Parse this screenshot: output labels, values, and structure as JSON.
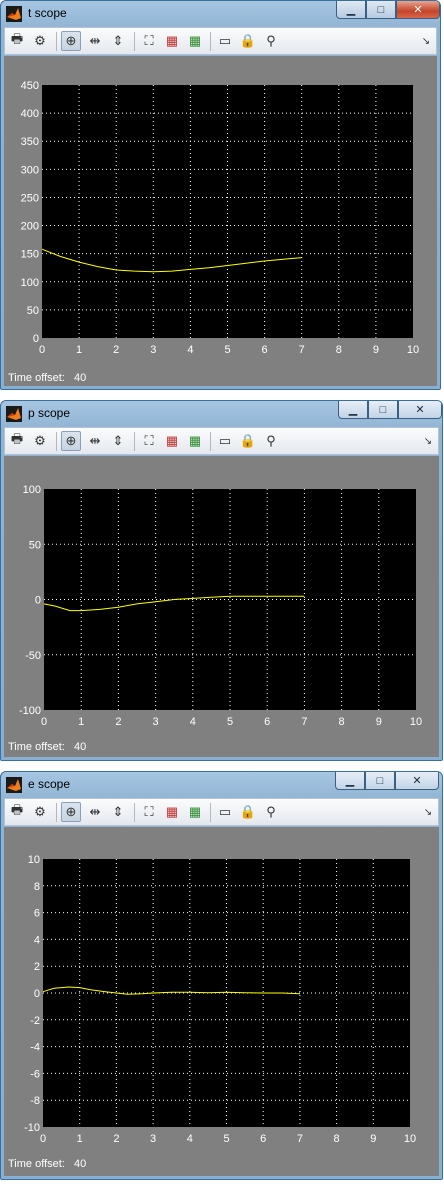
{
  "windows": [
    {
      "title": "t scope",
      "active": true,
      "time_offset_label": "Time offset:",
      "time_offset_value": "40",
      "chart_data": {
        "type": "line",
        "xlim": [
          0,
          10
        ],
        "ylim": [
          0,
          450
        ],
        "xticks": [
          "0",
          "1",
          "2",
          "3",
          "4",
          "5",
          "6",
          "7",
          "8",
          "9",
          "10"
        ],
        "yticks": [
          "0",
          "50",
          "100",
          "150",
          "200",
          "250",
          "300",
          "350",
          "400",
          "450"
        ],
        "grid": true,
        "series": [
          {
            "color": "#ffff00",
            "x": [
              0,
              0.5,
              1,
              1.5,
              2,
              2.5,
              3,
              3.5,
              4,
              4.5,
              5,
              5.5,
              6,
              6.5,
              7
            ],
            "y": [
              158,
              145,
              135,
              127,
              121,
              119,
              118,
              119,
              122,
              125,
              129,
              133,
              137,
              140,
              143
            ]
          }
        ]
      }
    },
    {
      "title": "p scope",
      "active": false,
      "time_offset_label": "Time offset:",
      "time_offset_value": "40",
      "chart_data": {
        "type": "line",
        "xlim": [
          0,
          10
        ],
        "ylim": [
          -100,
          100
        ],
        "xticks": [
          "0",
          "1",
          "2",
          "3",
          "4",
          "5",
          "6",
          "7",
          "8",
          "9",
          "10"
        ],
        "yticks": [
          "-100",
          "-50",
          "0",
          "50",
          "100"
        ],
        "grid": true,
        "series": [
          {
            "color": "#ffff00",
            "x": [
              0,
              0.3,
              0.7,
              1,
              1.5,
              2,
              2.5,
              3,
              3.5,
              4,
              4.5,
              5,
              5.5,
              6,
              6.5,
              7
            ],
            "y": [
              -4,
              -6,
              -10,
              -10,
              -9,
              -7,
              -4,
              -2,
              0,
              1,
              2,
              3,
              3,
              3,
              3,
              3
            ]
          }
        ]
      }
    },
    {
      "title": "e scope",
      "active": false,
      "time_offset_label": "Time offset:",
      "time_offset_value": "40",
      "chart_data": {
        "type": "line",
        "xlim": [
          0,
          10
        ],
        "ylim": [
          -10,
          10
        ],
        "xticks": [
          "0",
          "1",
          "2",
          "3",
          "4",
          "5",
          "6",
          "7",
          "8",
          "9",
          "10"
        ],
        "yticks": [
          "-10",
          "-8",
          "-6",
          "-4",
          "-2",
          "0",
          "2",
          "4",
          "6",
          "8",
          "10"
        ],
        "grid": true,
        "series": [
          {
            "color": "#ffff00",
            "x": [
              0,
              0.3,
              0.7,
              1,
              1.3,
              1.7,
              2,
              2.3,
              2.7,
              3,
              3.5,
              4,
              4.5,
              5,
              5.5,
              6,
              6.5,
              7
            ],
            "y": [
              0.1,
              0.35,
              0.45,
              0.4,
              0.25,
              0.1,
              0,
              -0.1,
              -0.05,
              0,
              0.05,
              0.05,
              0.02,
              0.05,
              0.02,
              0,
              0,
              -0.05
            ]
          }
        ]
      }
    }
  ],
  "toolbar_icons": [
    "print-icon",
    "parameters-icon",
    "zoom-in-icon",
    "zoom-x-icon",
    "zoom-y-icon",
    "autoscale-icon",
    "save-axes-icon",
    "restore-axes-icon",
    "floating-scope-icon",
    "lock-axes-icon",
    "signal-selection-icon",
    "dock-arrow-icon"
  ]
}
